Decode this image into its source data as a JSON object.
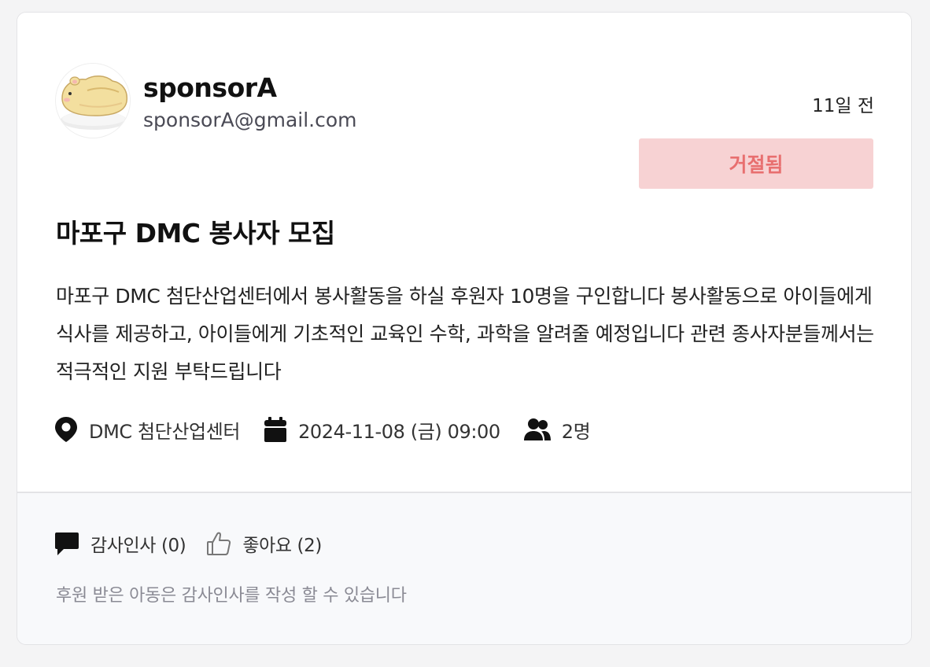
{
  "user": {
    "name": "sponsorA",
    "email": "sponsorA@gmail.com",
    "avatar_icon": "hamster-avatar-icon"
  },
  "post": {
    "time_ago": "11일 전",
    "status": "거절됨",
    "title": "마포구 DMC 봉사자 모집",
    "body": "마포구 DMC 첨단산업센터에서 봉사활동을 하실 후원자 10명을 구인합니다 봉사활동으로 아이들에게 식사를 제공하고, 아이들에게 기초적인 교육인 수학, 과학을 알려줄 예정입니다 관련 종사자분들께서는 적극적인 지원 부탁드립니다",
    "location": "DMC 첨단산업센터",
    "datetime": "2024-11-08 (금) 09:00",
    "people": "2명"
  },
  "actions": {
    "thanks": "감사인사 (0)",
    "likes": "좋아요 (2)",
    "notice": "후원 받은 아동은 감사인사를 작성 할 수 있습니다"
  },
  "colors": {
    "status_bg": "#f7d2d3",
    "status_text": "#e86f6f",
    "footer_bg": "#f8f9fb"
  }
}
